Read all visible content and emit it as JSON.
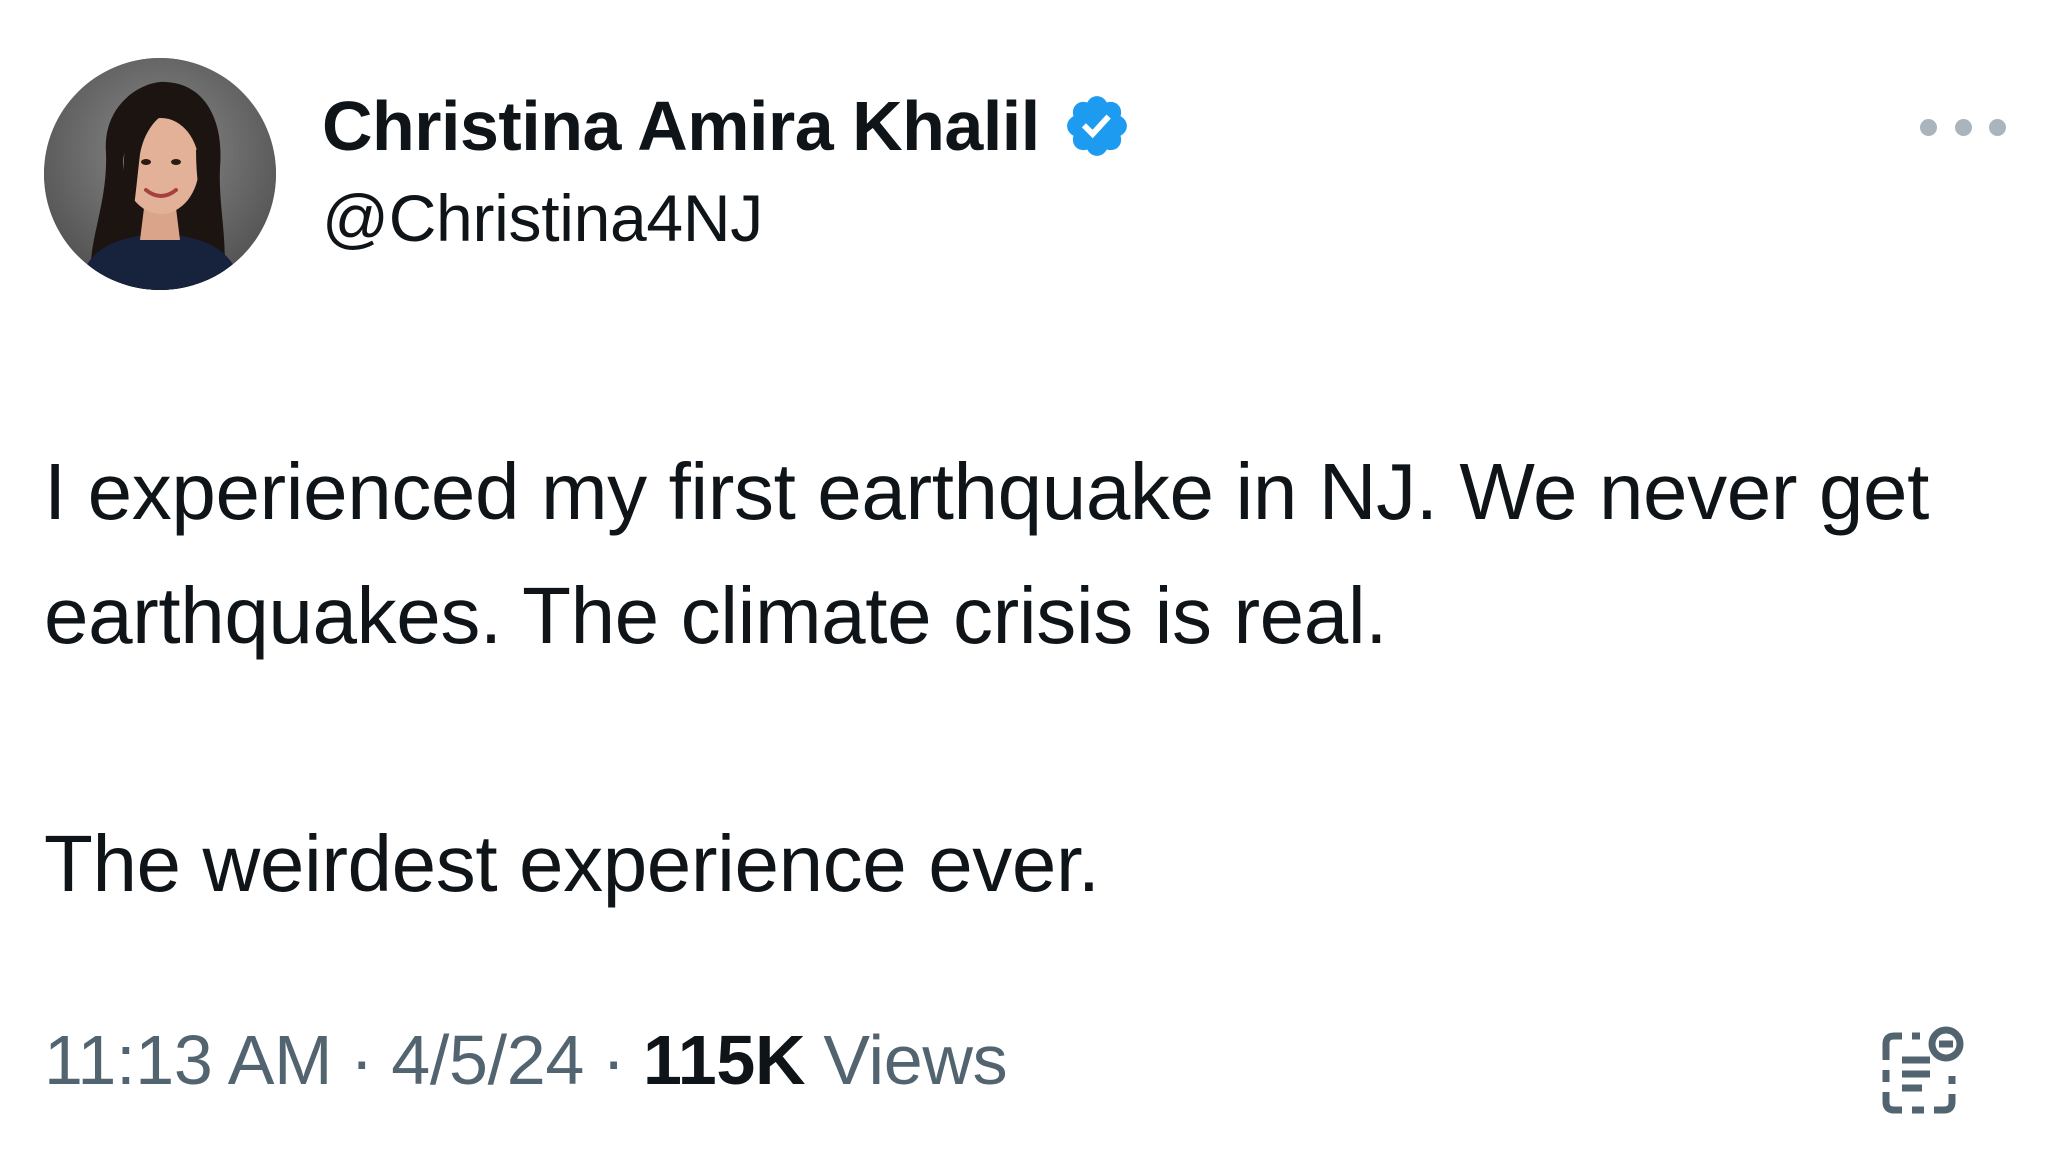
{
  "author": {
    "display_name": "Christina Amira Khalil",
    "handle": "@Christina4NJ",
    "verified": true,
    "verified_color": "#1d9bf0",
    "avatar_icon": "profile-photo"
  },
  "tweet": {
    "paragraphs": [
      "I experienced my first earthquake in NJ. We never get earthquakes. The climate crisis is real.",
      "The weirdest experience ever."
    ]
  },
  "meta": {
    "time": "11:13 AM",
    "separator": "·",
    "date": "4/5/24",
    "views_count": "115K",
    "views_label": "Views"
  },
  "icons": {
    "more": "more-horizontal-icon",
    "analytics": "analytics-icon"
  },
  "colors": {
    "text_primary": "#0f1419",
    "text_secondary": "#536471",
    "more_dots": "#a9b4bd"
  }
}
